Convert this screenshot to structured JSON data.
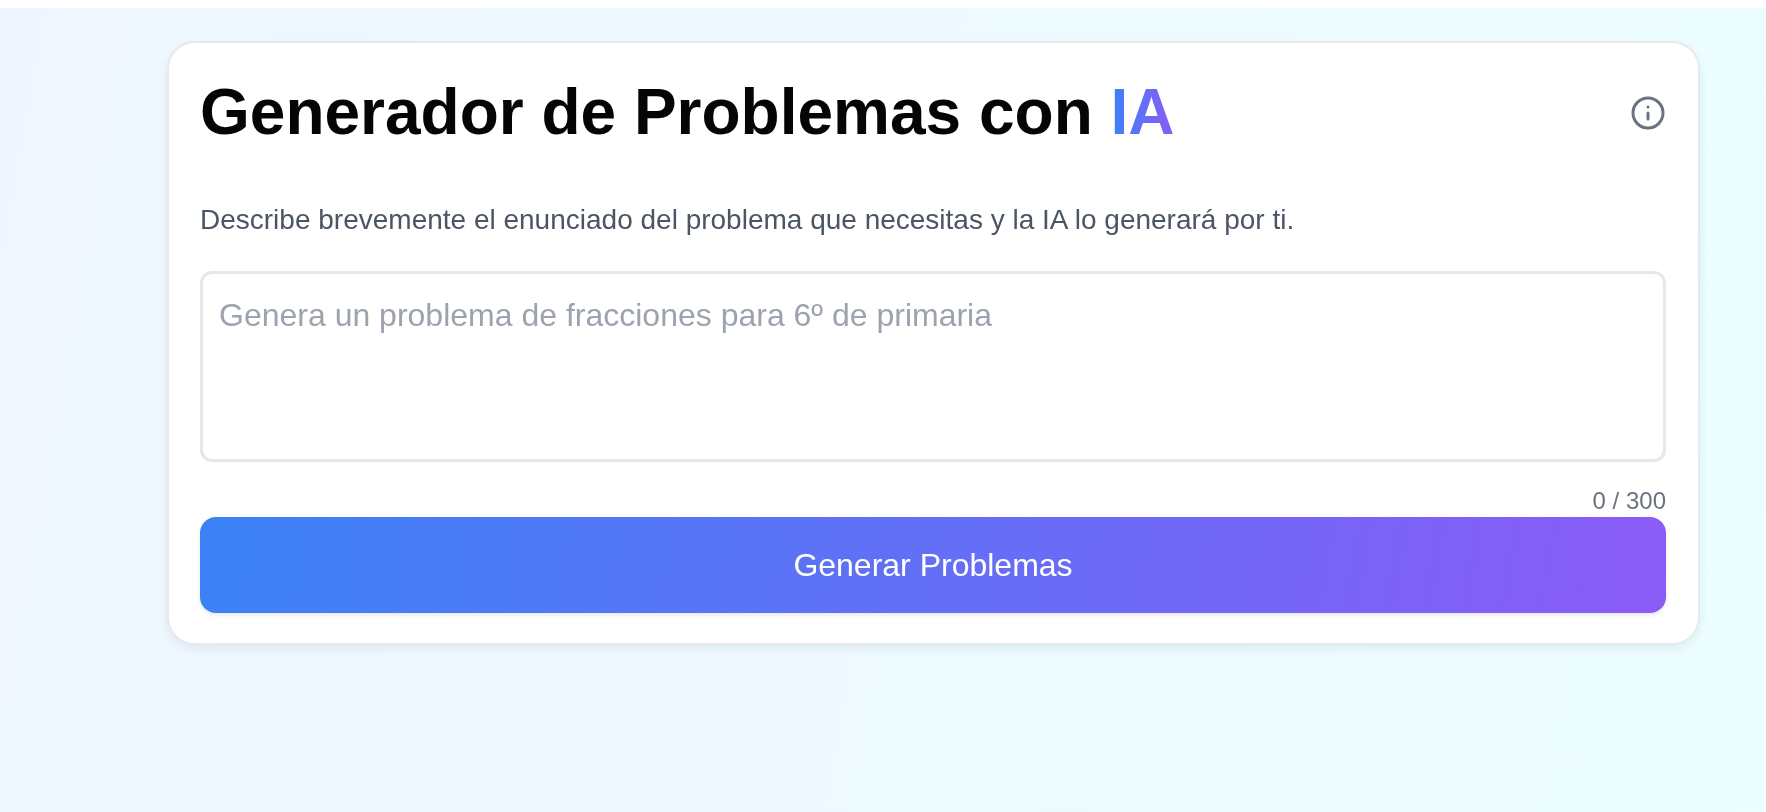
{
  "header": {
    "title": [
      {
        "text": "Generador de Problemas con",
        "kind": "plain"
      },
      {
        "text": "IA",
        "kind": "gradient"
      }
    ]
  },
  "description": "Describe brevemente el enunciado del problema que necesitas y la IA lo generará por ti.",
  "prompt": {
    "placeholder": "Genera un problema de fracciones para 6º de primaria",
    "counter": "0 / 300"
  },
  "button": {
    "label": "Generar Problemas"
  }
}
